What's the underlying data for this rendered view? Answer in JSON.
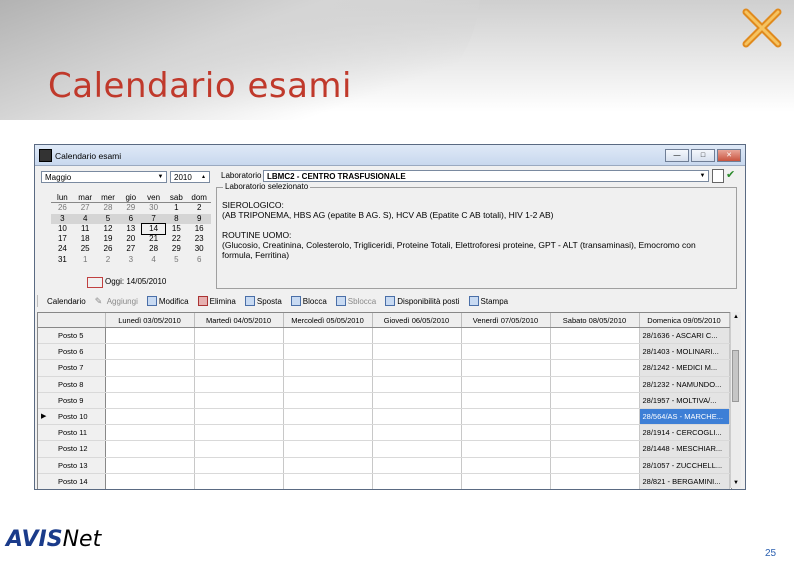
{
  "slide": {
    "title": "Calendario esami",
    "page_number": "25",
    "logo_text": "AVIS",
    "logo_suffix": "Net"
  },
  "window": {
    "title": "Calendario esami",
    "buttons": [
      "—",
      "□",
      "✕"
    ]
  },
  "calendar": {
    "month": "Maggio",
    "year": "2010",
    "weekdays": [
      "lun",
      "mar",
      "mer",
      "gio",
      "ven",
      "sab",
      "dom"
    ],
    "weeks": [
      [
        "26",
        "27",
        "28",
        "29",
        "30",
        "1",
        "2"
      ],
      [
        "3",
        "4",
        "5",
        "6",
        "7",
        "8",
        "9"
      ],
      [
        "10",
        "11",
        "12",
        "13",
        "14",
        "15",
        "16"
      ],
      [
        "17",
        "18",
        "19",
        "20",
        "21",
        "22",
        "23"
      ],
      [
        "24",
        "25",
        "26",
        "27",
        "28",
        "29",
        "30"
      ],
      [
        "31",
        "1",
        "2",
        "3",
        "4",
        "5",
        "6"
      ]
    ],
    "today_label": "Oggi: 14/05/2010"
  },
  "laboratorio": {
    "label": "Laboratorio",
    "value": "LBMC2 - CENTRO TRASFUSIONALE"
  },
  "selected_lab": {
    "legend": "Laboratorio selezionato",
    "section1_title": "SIEROLOGICO:",
    "section1_text": "(AB TRIPONEMA, HBS AG (epatite B AG. S), HCV AB (Epatite C AB totali), HIV 1-2 AB)",
    "section2_title": "ROUTINE UOMO:",
    "section2_text": "(Glucosio, Creatinina, Colesterolo, Trigliceridi, Proteine Totali, Elettroforesi proteine, GPT - ALT (transaminasi), Emocromo con formula, Ferritina)"
  },
  "toolbar": {
    "calendario": "Calendario",
    "aggiungi": "Aggiungi",
    "modifica": "Modifica",
    "elimina": "Elimina",
    "sposta": "Sposta",
    "blocca": "Blocca",
    "sblocca": "Sblocca",
    "disponibilita": "Disponibilità posti",
    "stampa": "Stampa"
  },
  "grid": {
    "columns": [
      "Lunedì 03/05/2010",
      "Martedì 04/05/2010",
      "Mercoledì 05/05/2010",
      "Giovedì 06/05/2010",
      "Venerdì 07/05/2010",
      "Sabato 08/05/2010",
      "Domenica 09/05/2010"
    ],
    "rows": [
      {
        "posto": "Posto 5",
        "sunday": "28/1636 - ASCARI C..."
      },
      {
        "posto": "Posto 6",
        "sunday": "28/1403 - MOLINARI..."
      },
      {
        "posto": "Posto 7",
        "sunday": "28/1242 - MEDICI M..."
      },
      {
        "posto": "Posto 8",
        "sunday": "28/1232 - NAMUNDO..."
      },
      {
        "posto": "Posto 9",
        "sunday": "28/1957 - MOLTIVA/..."
      },
      {
        "posto": "Posto 10",
        "sunday": "28/564/AS - MARCHE..."
      },
      {
        "posto": "Posto 11",
        "sunday": "28/1914 - CERCOGLI..."
      },
      {
        "posto": "Posto 12",
        "sunday": "28/1448 - MESCHIAR..."
      },
      {
        "posto": "Posto 13",
        "sunday": "28/1057 - ZUCCHELL..."
      },
      {
        "posto": "Posto 14",
        "sunday": "28/821 - BERGAMINI..."
      }
    ]
  }
}
